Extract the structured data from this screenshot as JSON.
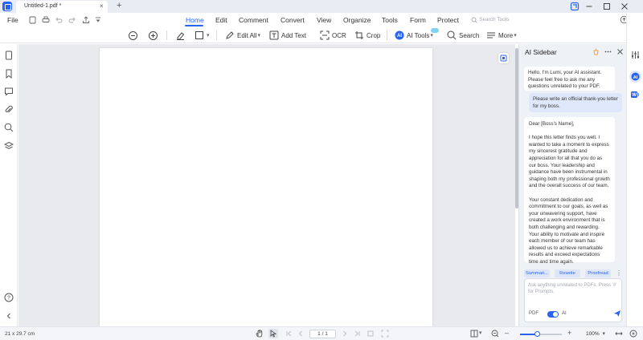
{
  "colors": {
    "accent": "#2764f5",
    "canvas": "#e9eaee",
    "sidebar": "#eef1f6"
  },
  "titlebar": {
    "tab_title": "Untitled-1.pdf *",
    "close_glyph": "×",
    "new_tab_glyph": "+"
  },
  "menubar": {
    "file": "File",
    "items": [
      "Home",
      "Edit",
      "Comment",
      "Convert",
      "View",
      "Organize",
      "Tools",
      "Form",
      "Protect"
    ],
    "search_placeholder": "Search Tools"
  },
  "toolbar": {
    "edit_all": "Edit All",
    "add_text": "Add Text",
    "ocr": "OCR",
    "crop": "Crop",
    "ai_tools": "AI Tools",
    "search": "Search",
    "more": "More",
    "dropdown_glyph": "▾"
  },
  "ai_sidebar": {
    "title": "AI Sidebar",
    "intro_message": "Hello, I'm Lumi, your AI assistant. Please feel free to ask me any questions unrelated to your PDF.",
    "user_message": "Please write an official thank-you letter for my boss.",
    "letter_response": "Dear [Boss's Name],\n\nI hope this letter finds you well. I wanted to take a moment to express my sincerest gratitude and appreciation for all that you do as our boss. Your leadership and guidance have been instrumental in shaping both my professional growth and the overall success of our team.\n\nYour constant dedication and commitment to our goals, as well as your unwavering support, have created a work environment that is both challenging and rewarding. Your ability to motivate and inspire each member of our team has allowed us to achieve remarkable results and exceed expectations time and time again.",
    "actions": [
      "Summari...",
      "Rewrite",
      "Proofread"
    ],
    "more_glyph": "⋮",
    "prompt_placeholder": "Ask anything unrelated to PDFs. Press '#' for Prompts.",
    "pdf_label": "PDF",
    "ai_label": "AI"
  },
  "statusbar": {
    "page_size": "21 x 29.7 cm",
    "page_indicator": "1 / 1",
    "zoom": "100%"
  }
}
